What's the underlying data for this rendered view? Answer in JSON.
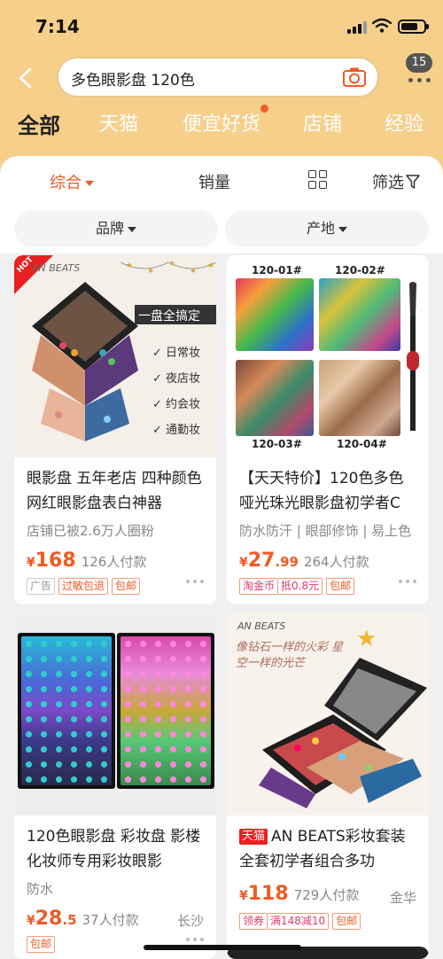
{
  "status_bar": {
    "time": "7:14"
  },
  "search": {
    "query": "多色眼影盘 120色",
    "badge_count": "15"
  },
  "tabs": [
    {
      "label": "全部",
      "active": true
    },
    {
      "label": "天猫"
    },
    {
      "label": "便宜好货"
    },
    {
      "label": "店铺"
    },
    {
      "label": "经验"
    }
  ],
  "sort": {
    "comprehensive": "综合",
    "sales": "销量",
    "filter": "筛选"
  },
  "filters": {
    "brand": "品牌",
    "origin": "产地"
  },
  "products": [
    {
      "title": "眼影盘 五年老店 四种颜色网红眼影盘表白神器",
      "subtitle": "店铺已被2.6万人圈粉",
      "currency": "¥",
      "price_int": "168",
      "price_dec": "",
      "sold": "126人付款",
      "location": "",
      "tags": [
        "广告",
        "过敏包退",
        "包邮"
      ],
      "image_text": {
        "corner": "HOT",
        "brand": "AN BEATS",
        "slogan": "一盘全搞定",
        "uses": [
          "日常妆",
          "夜店妆",
          "约会妆",
          "通勤妆"
        ]
      }
    },
    {
      "title": "【天天特价】120色多色哑光珠光眼影盘初学者C",
      "subtitle": "防水防汗 | 眼部修饰 | 易上色",
      "currency": "¥",
      "price_int": "27",
      "price_dec": ".99",
      "sold": "264人付款",
      "location": "",
      "tags": [
        "淘金币",
        "抵0.8元",
        "包邮"
      ],
      "image_text": {
        "codes": [
          "120-01#",
          "120-02#",
          "120-03#",
          "120-04#"
        ]
      }
    },
    {
      "title": "120色眼影盘 彩妆盘 影楼化妆师专用彩妆眼影",
      "subtitle": "防水",
      "currency": "¥",
      "price_int": "28",
      "price_dec": ".5",
      "sold": "37人付款",
      "location": "长沙",
      "tags": [
        "包邮"
      ]
    },
    {
      "title_tag": "天猫",
      "title": "AN BEATS彩妆套装全套初学者组合多功",
      "subtitle": "",
      "currency": "¥",
      "price_int": "118",
      "price_dec": "",
      "sold": "729人付款",
      "location": "金华",
      "tags": [
        "领券",
        "满148减10",
        "包邮"
      ],
      "image_text": {
        "brand": "AN BEATS",
        "slogan": "像钻石一样的火彩 星空一样的光芒"
      }
    }
  ],
  "colors": {
    "accent": "#f05a23",
    "header_bg": "#f6cf8a",
    "tmall_red": "#e8201f"
  }
}
